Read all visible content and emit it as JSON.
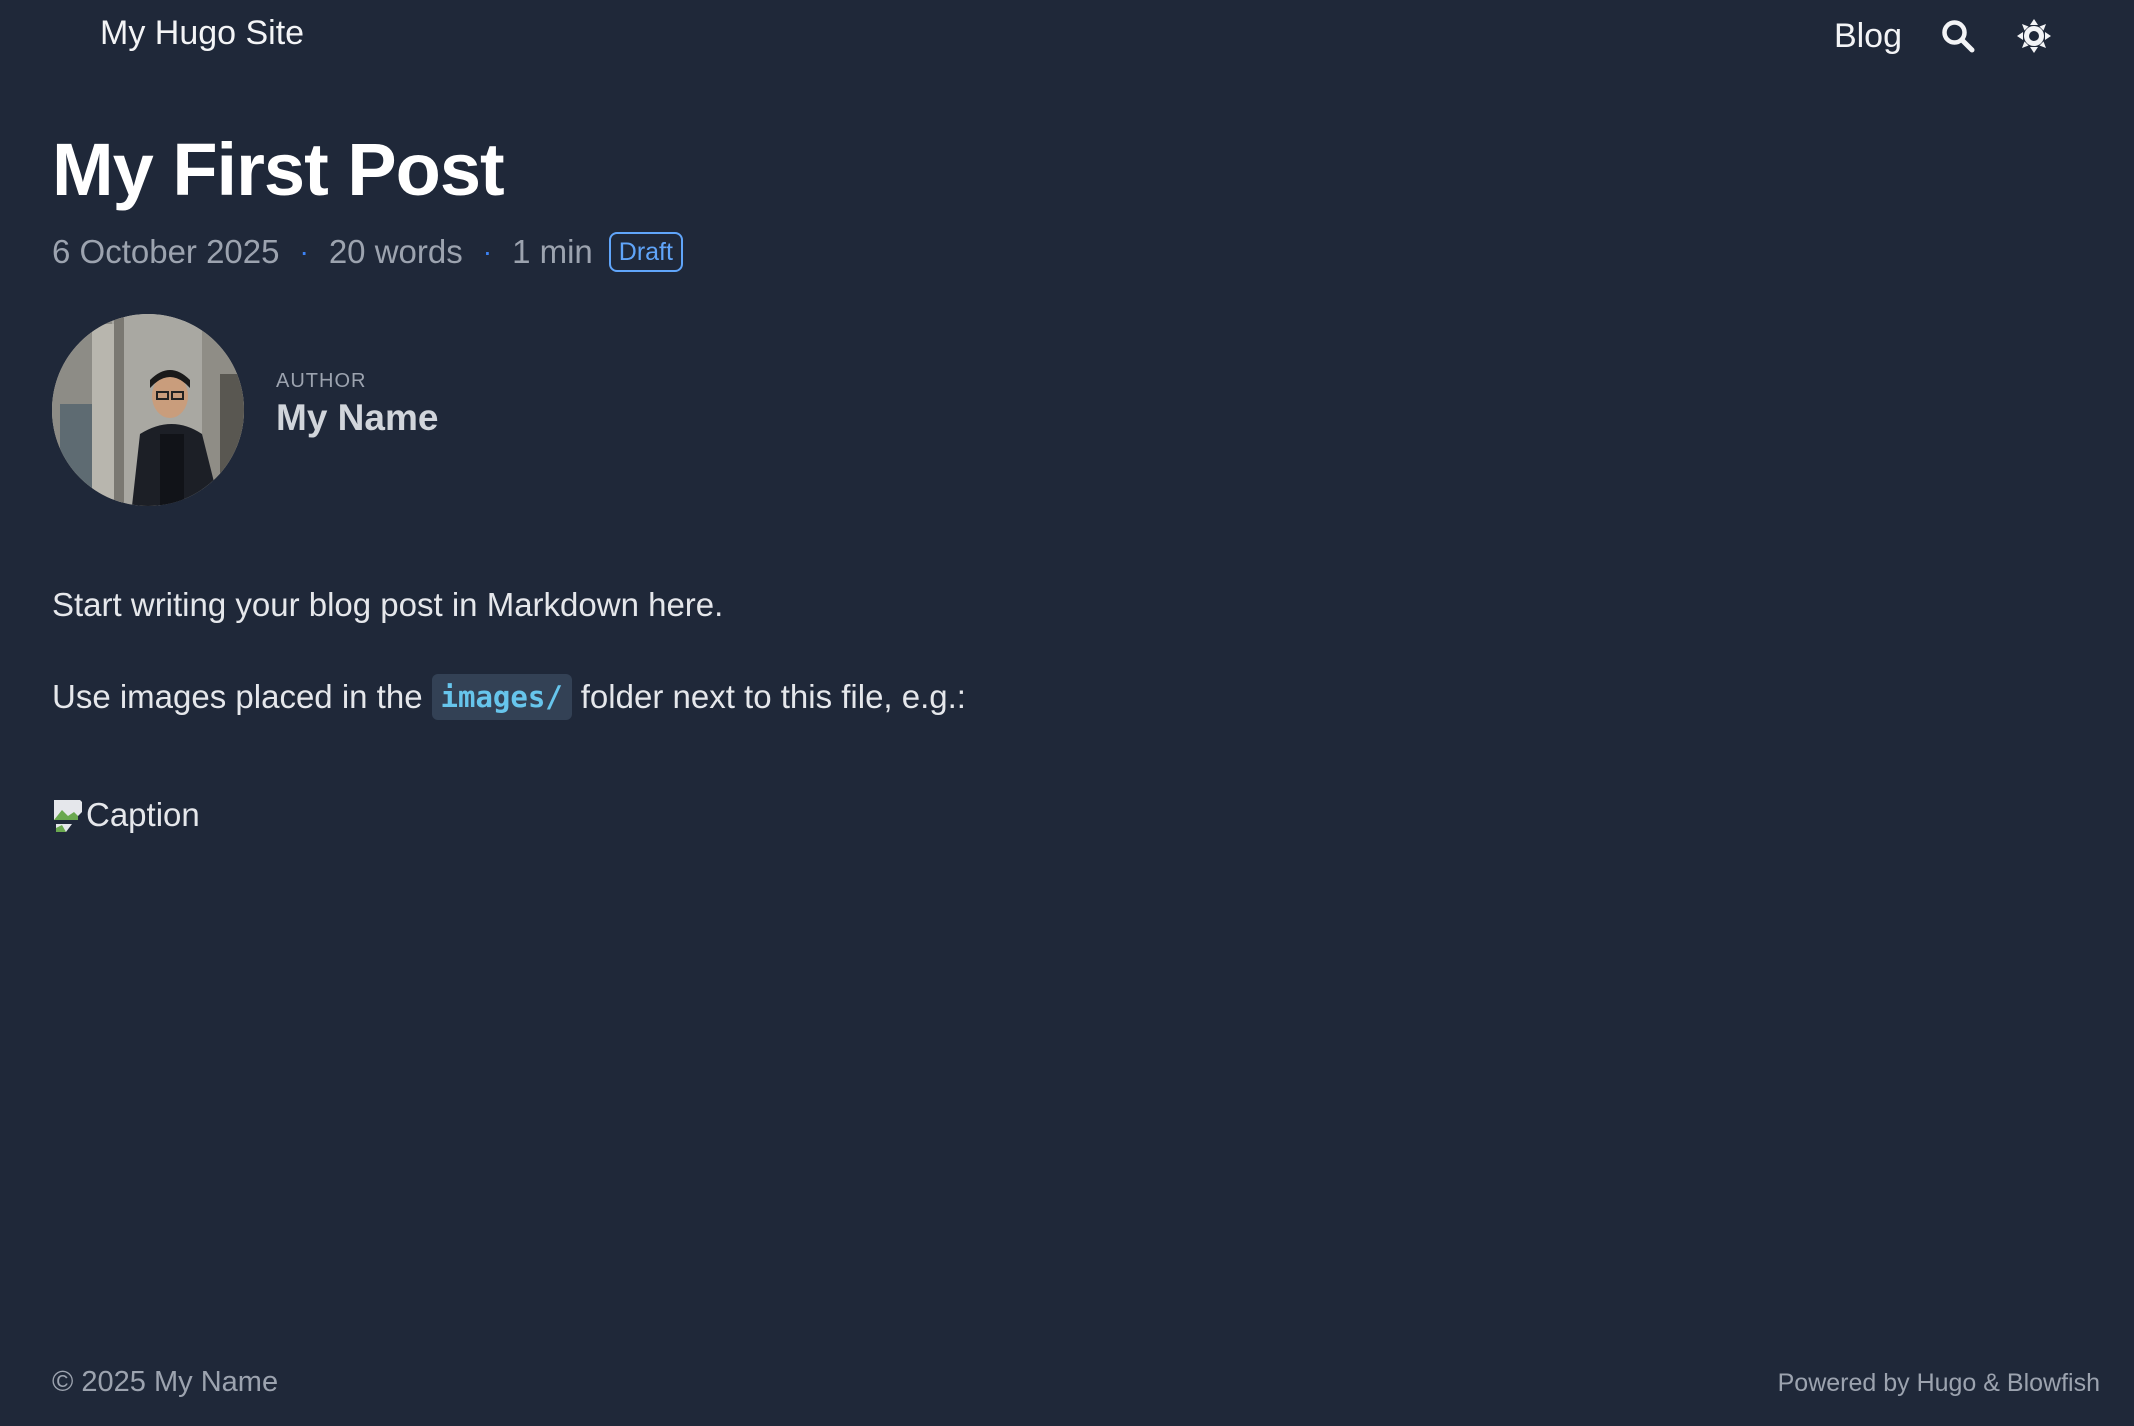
{
  "header": {
    "site_title": "My Hugo Site",
    "nav": [
      {
        "label": "Blog"
      }
    ],
    "icons": {
      "search": "search-icon",
      "appearance": "sun-icon"
    }
  },
  "post": {
    "title": "My First Post",
    "date": "6 October 2025",
    "separator": "·",
    "word_count": "20 words",
    "reading_time": "1 min",
    "badge": "Draft"
  },
  "author": {
    "label": "AUTHOR",
    "name": "My Name"
  },
  "content": {
    "paragraph1": "Start writing your blog post in Markdown here.",
    "paragraph2_before": "Use images placed in the",
    "paragraph2_code": "images/",
    "paragraph2_after": "folder next to this file, e.g.:",
    "image_alt": "Caption"
  },
  "footer": {
    "copyright": "© 2025 My Name",
    "powered_by": "Powered by Hugo & Blowfish"
  },
  "colors": {
    "background": "#1f2839",
    "accent": "#60a5fa",
    "code": "#67c5ec"
  }
}
